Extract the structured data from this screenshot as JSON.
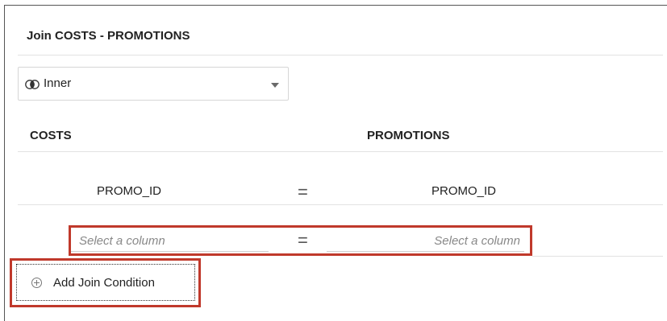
{
  "dialog": {
    "title": "Join COSTS - PROMOTIONS"
  },
  "join_type": {
    "selected": "Inner",
    "icon": "venn-inner-join-icon"
  },
  "columns": {
    "left_header": "COSTS",
    "right_header": "PROMOTIONS"
  },
  "conditions": [
    {
      "left": "PROMO_ID",
      "operator": "=",
      "right": "PROMO_ID"
    },
    {
      "left_placeholder": "Select a column",
      "operator": "=",
      "right_placeholder": "Select a column"
    }
  ],
  "add_condition": {
    "label": "Add Join Condition",
    "icon": "plus-circle-icon"
  },
  "colors": {
    "highlight": "#c0392b"
  }
}
